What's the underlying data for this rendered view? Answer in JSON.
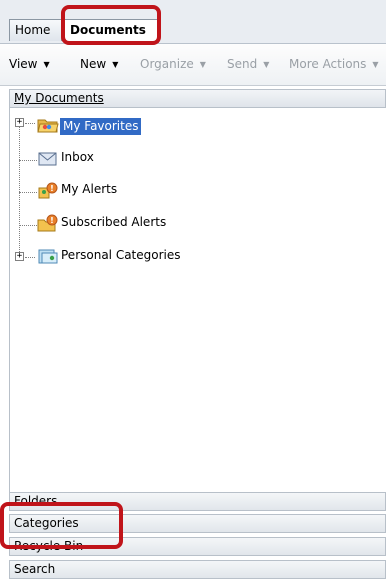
{
  "tabs": {
    "home": "Home",
    "documents": "Documents"
  },
  "toolbar": {
    "view": "View",
    "new": "New",
    "organize": "Organize",
    "send": "Send",
    "more_actions": "More Actions"
  },
  "section_title": "My Documents",
  "tree": {
    "items": [
      {
        "label": "My Favorites",
        "icon": "favorites-folder-icon",
        "selected": true
      },
      {
        "label": "Inbox",
        "icon": "inbox-envelope-icon"
      },
      {
        "label": "My Alerts",
        "icon": "alerts-icon"
      },
      {
        "label": "Subscribed Alerts",
        "icon": "subscribed-alerts-icon"
      },
      {
        "label": "Personal Categories",
        "icon": "personal-categories-icon"
      }
    ]
  },
  "panels": {
    "folders": "Folders",
    "categories": "Categories",
    "recycle_bin": "Recycle Bin",
    "search": "Search"
  },
  "colors": {
    "highlight": "#c0141a",
    "selection": "#316ac5"
  }
}
